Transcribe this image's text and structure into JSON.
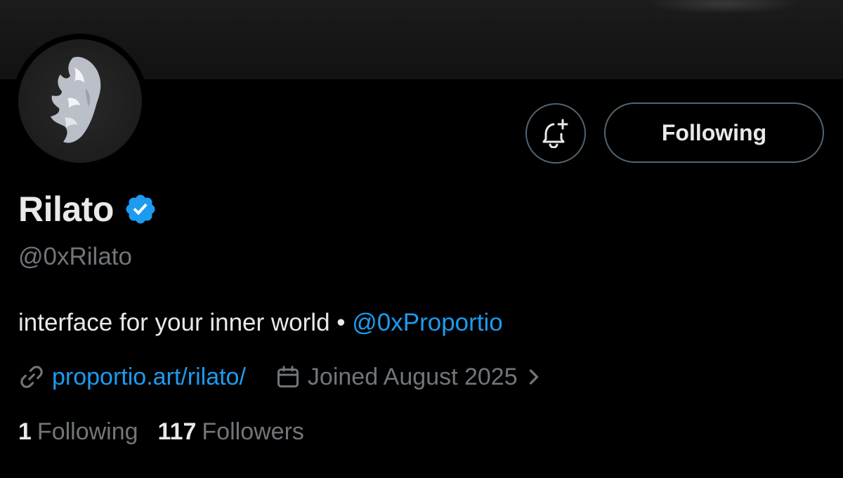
{
  "profile": {
    "display_name": "Rilato",
    "handle": "@0xRilato",
    "bio_text": "interface for your inner world • ",
    "bio_mention": "@0xProportio",
    "website": "proportio.art/rilato/",
    "joined": "Joined August 2025",
    "verified": true
  },
  "actions": {
    "follow_label": "Following",
    "notify_icon": "bell-plus-icon"
  },
  "stats": {
    "following_count": "1",
    "following_label": "Following",
    "followers_count": "117",
    "followers_label": "Followers"
  },
  "colors": {
    "background": "#000000",
    "text_primary": "#e7e9ea",
    "text_secondary": "#71767b",
    "accent": "#1d9bf0",
    "border": "#536471"
  }
}
